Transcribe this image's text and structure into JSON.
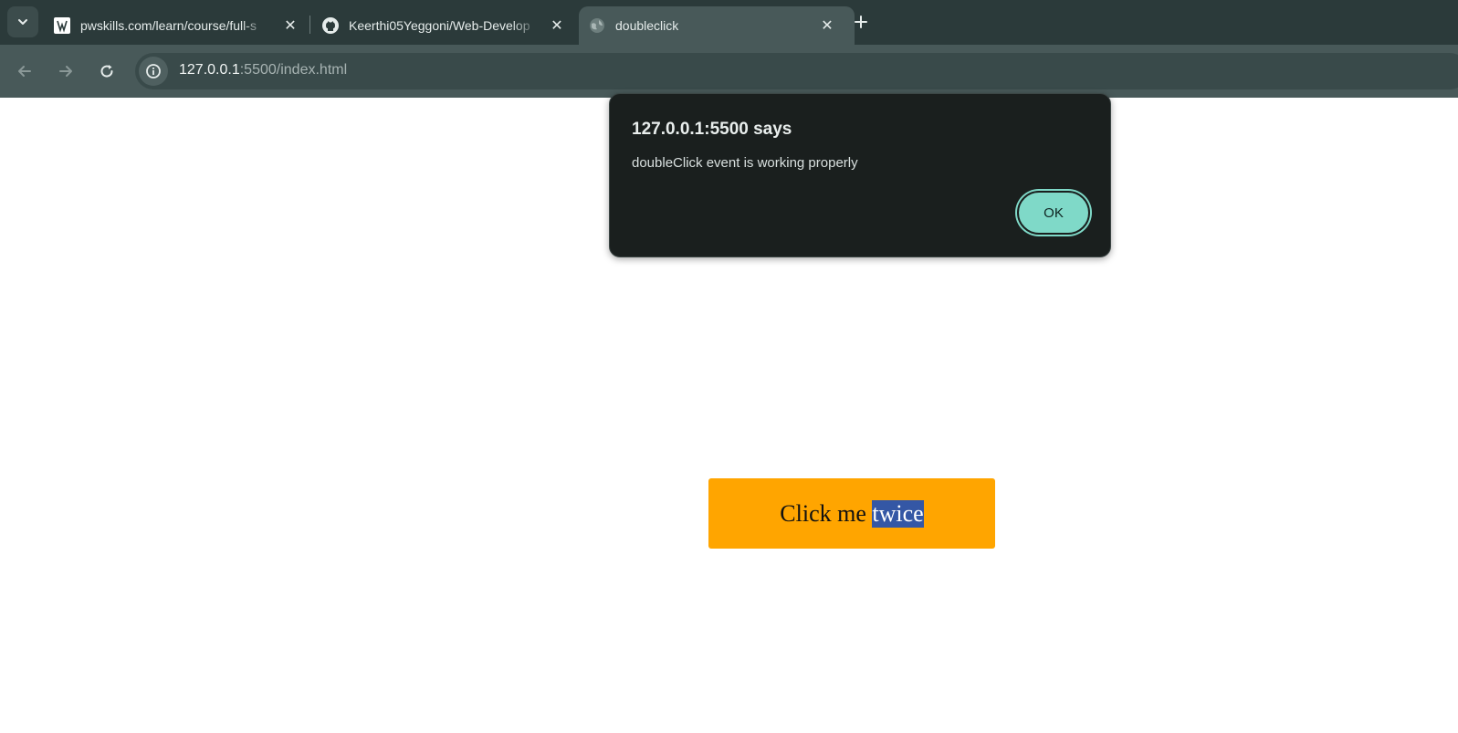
{
  "browser": {
    "tabs": [
      {
        "title": "pwskills.com/learn/course/full-s",
        "favicon": "pwskills-favicon",
        "active": false
      },
      {
        "title": "Keerthi05Yeggoni/Web-Develop",
        "favicon": "github-icon",
        "active": false
      },
      {
        "title": "doubleclick",
        "favicon": "globe-icon",
        "active": true
      }
    ],
    "url_host": "127.0.0.1",
    "url_rest": ":5500/index.html"
  },
  "page": {
    "button_text_plain": "Click me ",
    "button_text_selected": "twice",
    "button_color": "#ffa500"
  },
  "alert": {
    "title": "127.0.0.1:5500 says",
    "message": "doubleClick event is working properly",
    "ok_label": "OK",
    "accent": "#7fd9c8"
  }
}
